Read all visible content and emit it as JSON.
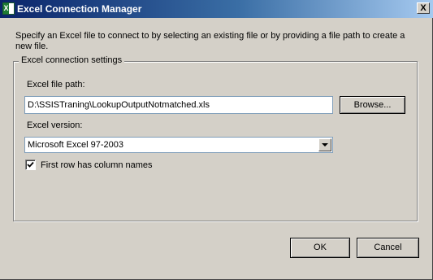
{
  "window": {
    "title": "Excel Connection Manager",
    "icon": "excel-icon",
    "icon_letter": "X",
    "close_label": "X"
  },
  "description": "Specify an Excel file to connect to by selecting an existing file or by providing a file path to create a new file.",
  "settings": {
    "group_title": "Excel connection settings",
    "file_path_label": "Excel file path:",
    "file_path_value": "D:\\SSISTraning\\LookupOutputNotmatched.xls",
    "browse_label": "Browse...",
    "version_label": "Excel version:",
    "version_value": "Microsoft Excel 97-2003",
    "first_row_label": "First row has column names",
    "first_row_checked": true
  },
  "buttons": {
    "ok_label": "OK",
    "cancel_label": "Cancel"
  },
  "colors": {
    "title_gradient_start": "#0a246a",
    "title_gradient_end": "#a6caf0",
    "dialog_background": "#d4d0c8"
  }
}
